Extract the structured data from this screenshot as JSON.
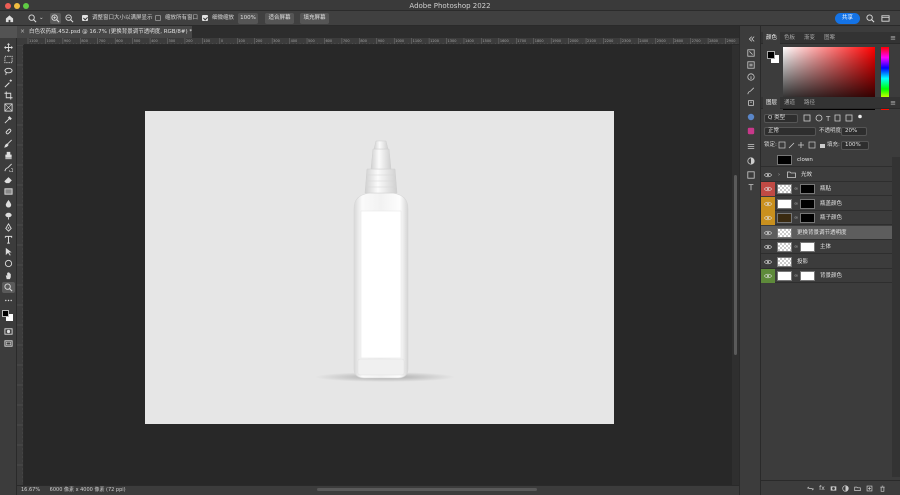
{
  "window": {
    "title": "Adobe Photoshop 2022"
  },
  "options_bar": {
    "resize_windows_label": "调整窗口大小以满屏显示",
    "resize_windows_checked": true,
    "zoom_all_label": "缩放所有窗口",
    "zoom_all_checked": false,
    "scrubby_zoom_label": "细微缩放",
    "scrubby_zoom_checked": true,
    "zoom_100_label": "100%",
    "fit_screen_label": "适合屏幕",
    "fill_screen_label": "填充屏幕",
    "share_label": "共享"
  },
  "document": {
    "tab_title": "白色农药瓶.452.psd @ 16.7% (更换背景调节透明度, RGB/8#) *",
    "close_glyph": "×"
  },
  "rulers": {
    "top_ticks": [
      "1100",
      "1000",
      "900",
      "800",
      "700",
      "600",
      "500",
      "400",
      "300",
      "200",
      "100",
      "0",
      "100",
      "200",
      "300",
      "400",
      "500",
      "600",
      "700",
      "800",
      "900",
      "1000",
      "1100",
      "1200",
      "1300",
      "1400",
      "1500",
      "1600",
      "1700",
      "1800",
      "1900",
      "2000",
      "2100",
      "2200",
      "2300",
      "2400",
      "2500",
      "2600",
      "2700",
      "2800",
      "2900"
    ]
  },
  "status": {
    "zoom": "16.67%",
    "dimensions": "6000 像素 x 4000 像素 (72 ppi)"
  },
  "color_panel": {
    "tabs": [
      "颜色",
      "色板",
      "渐变",
      "图案"
    ],
    "active_tab": "颜色",
    "foreground": "#000000",
    "background": "#ffffff"
  },
  "layers_panel": {
    "tabs": [
      "图层",
      "通道",
      "路径"
    ],
    "active_tab": "图层",
    "filter_label": "Q 类型",
    "blend_mode": "正常",
    "opacity_label": "不透明度:",
    "opacity_value": "20%",
    "lock_label": "锁定:",
    "fill_label": "填充:",
    "fill_value": "100%",
    "layers": [
      {
        "name": "clown",
        "visible": false,
        "tag_color": "",
        "thumb": "black",
        "mask": "",
        "selected": false,
        "group": false
      },
      {
        "name": "光效",
        "visible": true,
        "tag_color": "",
        "thumb": "",
        "mask": "",
        "selected": false,
        "group": true
      },
      {
        "name": "瓶贴",
        "visible": true,
        "tag_color": "#c04a44",
        "thumb": "checker",
        "mask": "black",
        "selected": false,
        "group": false
      },
      {
        "name": "瓶盖颜色",
        "visible": true,
        "tag_color": "#c9901e",
        "thumb": "white",
        "mask": "black",
        "selected": false,
        "group": false
      },
      {
        "name": "瓶子颜色",
        "visible": true,
        "tag_color": "#c9901e",
        "thumb": "brown",
        "mask": "black",
        "selected": false,
        "group": false
      },
      {
        "name": "更换背景调节透明度",
        "visible": true,
        "tag_color": "",
        "thumb": "checker",
        "mask": "",
        "selected": true,
        "group": false
      },
      {
        "name": "主体",
        "visible": true,
        "tag_color": "",
        "thumb": "checker",
        "mask": "white",
        "selected": false,
        "group": false
      },
      {
        "name": "投影",
        "visible": true,
        "tag_color": "",
        "thumb": "checker",
        "mask": "",
        "selected": false,
        "group": false
      },
      {
        "name": "背景颜色",
        "visible": true,
        "tag_color": "#5e8a3a",
        "thumb": "white",
        "mask": "white",
        "selected": false,
        "group": false
      }
    ],
    "bottom_icons": [
      "link-icon",
      "fx-icon",
      "mask-icon",
      "adjustment-icon",
      "group-icon",
      "new-layer-icon",
      "trash-icon"
    ]
  },
  "colors": {
    "accent": "#1473e6",
    "canvas_bg": "#282828",
    "document_bg": "#e6e6e6",
    "panel_bg": "#3c3c3c"
  }
}
